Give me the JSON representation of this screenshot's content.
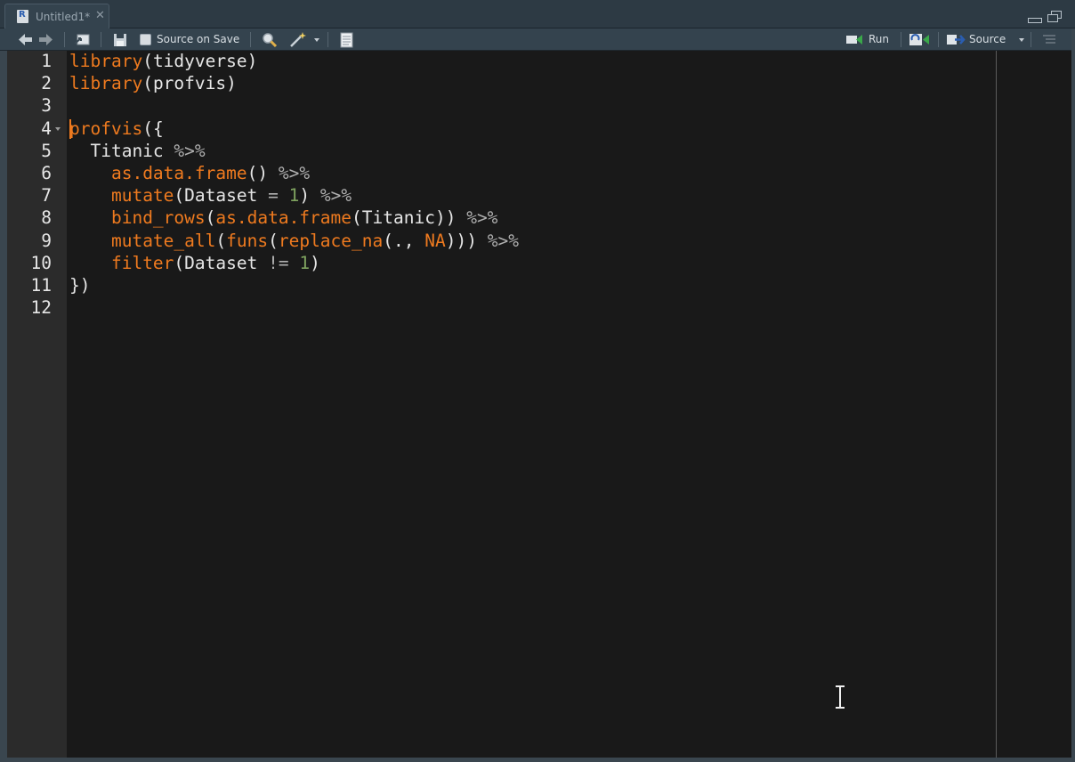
{
  "tab": {
    "title": "Untitled1*",
    "close_icon": "close-icon"
  },
  "toolbar": {
    "source_on_save_label": "Source on Save",
    "run_label": "Run",
    "source_label": "Source"
  },
  "editor": {
    "line_numbers": [
      "1",
      "2",
      "3",
      "4",
      "5",
      "6",
      "7",
      "8",
      "9",
      "10",
      "11",
      "12"
    ],
    "lines": [
      "library(tidyverse)",
      "library(profvis)",
      "",
      "profvis({",
      "  Titanic %>%",
      "    as.data.frame() %>%",
      "    mutate(Dataset = 1) %>%",
      "    bind_rows(as.data.frame(Titanic)) %>%",
      "    mutate_all(funs(replace_na(., NA))) %>%",
      "    filter(Dataset != 1)",
      "})",
      ""
    ]
  },
  "colors": {
    "function": "#ee7a1f",
    "text": "#e6e6e6",
    "operator": "#b0b0b0",
    "number": "#7fa35f",
    "background": "#191919"
  }
}
